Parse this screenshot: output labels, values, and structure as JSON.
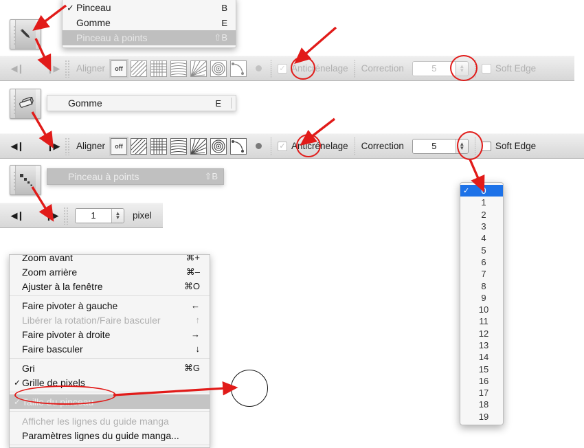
{
  "app": {
    "language": "fr",
    "accent_red": "#e11b19",
    "selection_blue": "#1d72e8"
  },
  "tool_menu": {
    "name": "tool-selection-menu",
    "items": [
      {
        "label": "Pinceau",
        "shortcut": "B",
        "checked": true,
        "state": "normal"
      },
      {
        "label": "Gomme",
        "shortcut": "E",
        "checked": false,
        "state": "normal"
      },
      {
        "label": "Pinceau à points",
        "shortcut": "⇧B",
        "checked": false,
        "state": "highlighted-disabled"
      }
    ]
  },
  "tool_buttons": {
    "brush": {
      "icon": "pencil-icon",
      "label": "Pinceau"
    },
    "eraser": {
      "icon": "eraser-icon",
      "label": "Gomme"
    },
    "dot_brush": {
      "icon": "dot-brush-icon",
      "label": "Pinceau à points"
    }
  },
  "strip_eraser": {
    "label": "Gomme",
    "shortcut": "E"
  },
  "strip_dotbrush": {
    "label": "Pinceau à points",
    "shortcut": "⇧B"
  },
  "optionbar_brush": {
    "state": "disabled",
    "prev_label": "◀❙",
    "next_label": "❙▶",
    "align_label": "Aligner",
    "patterns": [
      {
        "name": "align-off",
        "label": "off"
      },
      {
        "name": "align-diagonal-hatch"
      },
      {
        "name": "align-grid"
      },
      {
        "name": "align-horizontal-lines"
      },
      {
        "name": "align-radial-fan"
      },
      {
        "name": "align-concentric"
      },
      {
        "name": "align-curve"
      }
    ],
    "antialias_label": "Anticrénelage",
    "antialias_checked": true,
    "correction_label": "Correction",
    "correction_value": "5",
    "softedge_label": "Soft Edge",
    "softedge_checked": false
  },
  "optionbar_eraser": {
    "state": "enabled",
    "prev_label": "◀❙",
    "next_label": "❙▶",
    "align_label": "Aligner",
    "patterns": [
      {
        "name": "align-off",
        "label": "off"
      },
      {
        "name": "align-diagonal-hatch"
      },
      {
        "name": "align-grid"
      },
      {
        "name": "align-horizontal-lines"
      },
      {
        "name": "align-radial-fan"
      },
      {
        "name": "align-concentric"
      },
      {
        "name": "align-curve"
      }
    ],
    "antialias_label": "Anticrénelage",
    "antialias_checked": true,
    "correction_label": "Correction",
    "correction_value": "5",
    "softedge_label": "Soft Edge",
    "softedge_checked": false
  },
  "optionbar_dotbrush": {
    "prev_label": "◀❙",
    "next_label": "❙▶",
    "size_value": "1",
    "unit_label": "pixel"
  },
  "correction_dropdown": {
    "name": "correction-value-dropdown",
    "selected": "0",
    "options": [
      "0",
      "1",
      "2",
      "3",
      "4",
      "5",
      "6",
      "7",
      "8",
      "9",
      "10",
      "11",
      "12",
      "13",
      "14",
      "15",
      "16",
      "17",
      "18",
      "19"
    ]
  },
  "view_context_menu": {
    "groups": [
      [
        {
          "label": "Zoom avant",
          "key": "⌘+",
          "checked": false,
          "state": "normal",
          "clipped": true
        },
        {
          "label": "Zoom arrière",
          "key": "⌘–",
          "checked": false,
          "state": "normal"
        },
        {
          "label": "Ajuster à la fenêtre",
          "key": "⌘O",
          "checked": false,
          "state": "normal"
        }
      ],
      [
        {
          "label": "Faire pivoter à gauche",
          "key": "←",
          "checked": false,
          "state": "normal"
        },
        {
          "label": "Libérer la rotation/Faire basculer",
          "key": "↑",
          "checked": false,
          "state": "disabled"
        },
        {
          "label": "Faire pivoter à droite",
          "key": "→",
          "checked": false,
          "state": "normal"
        },
        {
          "label": "Faire basculer",
          "key": "↓",
          "checked": false,
          "state": "normal"
        }
      ],
      [
        {
          "label": "Gri",
          "key": "⌘G",
          "checked": false,
          "state": "normal"
        },
        {
          "label": "Grille de pixels",
          "key": "",
          "checked": true,
          "state": "normal"
        }
      ],
      [
        {
          "label": "Taille du pinceau",
          "key": "",
          "checked": true,
          "state": "highlighted-disabled"
        }
      ],
      [
        {
          "label": "Afficher les lignes du guide manga",
          "key": "",
          "checked": false,
          "state": "disabled"
        },
        {
          "label": "Paramètres lignes du guide manga...",
          "key": "",
          "checked": false,
          "state": "normal"
        }
      ]
    ]
  },
  "brush_preview": {
    "name": "brush-size-preview-circle",
    "shape": "circle-outline"
  },
  "annotations": {
    "red_arrows": 5,
    "red_ellipses": 5,
    "description": "Red callout arrows and ellipses highlighting the tool swatch, anticrénelage checkbox, correction stepper, and the Taille du pinceau menu entry"
  }
}
